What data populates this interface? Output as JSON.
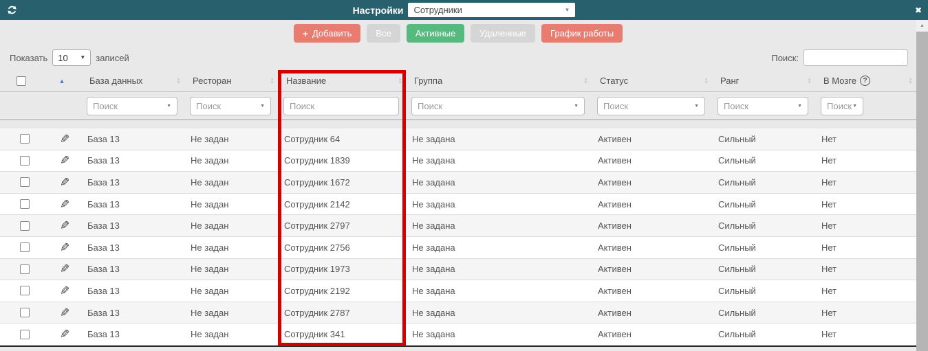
{
  "topbar": {
    "title": "Настройки",
    "module_select_value": "Сотрудники"
  },
  "toolbar": {
    "buttons": [
      {
        "name": "add",
        "label": "Добавить",
        "icon": "+",
        "variant": "salmon"
      },
      {
        "name": "all",
        "label": "Все",
        "variant": "gray"
      },
      {
        "name": "active",
        "label": "Активные",
        "variant": "green"
      },
      {
        "name": "deleted",
        "label": "Удаленные",
        "variant": "gray"
      },
      {
        "name": "work-schedule",
        "label": "График работы",
        "variant": "salmon"
      }
    ]
  },
  "length_control": {
    "prefix": "Показать",
    "value": "10",
    "suffix": "записей"
  },
  "search": {
    "label": "Поиск:",
    "value": ""
  },
  "icons": {
    "refresh": "circular-arrows",
    "close": "✖",
    "pencil": "✎",
    "caret_down": "▼",
    "sort_up": "▲",
    "sort_down": "▼",
    "help": "?"
  },
  "colors": {
    "topbar_teal": "#28606e",
    "accent_salmon": "#e87c71",
    "accent_green": "#56b97e",
    "button_gray": "#d5d5d5",
    "highlight_red": "#d40000",
    "sorted_arrow_blue": "#4a77d4"
  },
  "table": {
    "filter_placeholder": "Поиск",
    "columns": [
      {
        "key": "check",
        "type": "checkbox"
      },
      {
        "key": "edit",
        "sorted": "asc"
      },
      {
        "key": "db",
        "label": "База данных",
        "filter": "select"
      },
      {
        "key": "restaurant",
        "label": "Ресторан",
        "filter": "select"
      },
      {
        "key": "name",
        "label": "Название",
        "filter": "input",
        "highlighted": true
      },
      {
        "key": "group",
        "label": "Группа",
        "filter": "select"
      },
      {
        "key": "status",
        "label": "Статус",
        "filter": "select"
      },
      {
        "key": "rank",
        "label": "Ранг",
        "filter": "select"
      },
      {
        "key": "brain",
        "label": "В Мозге",
        "filter": "select",
        "help": true,
        "narrow_filter": true
      }
    ],
    "rows": [
      {
        "db": "База 13",
        "restaurant": "Не задан",
        "name": "Сотрудник 64",
        "group": "Не задана",
        "status": "Активен",
        "rank": "Сильный",
        "brain": "Нет"
      },
      {
        "db": "База 13",
        "restaurant": "Не задан",
        "name": "Сотрудник 1839",
        "group": "Не задана",
        "status": "Активен",
        "rank": "Сильный",
        "brain": "Нет"
      },
      {
        "db": "База 13",
        "restaurant": "Не задан",
        "name": "Сотрудник 1672",
        "group": "Не задана",
        "status": "Активен",
        "rank": "Сильный",
        "brain": "Нет"
      },
      {
        "db": "База 13",
        "restaurant": "Не задан",
        "name": "Сотрудник 2142",
        "group": "Не задана",
        "status": "Активен",
        "rank": "Сильный",
        "brain": "Нет"
      },
      {
        "db": "База 13",
        "restaurant": "Не задан",
        "name": "Сотрудник 2797",
        "group": "Не задана",
        "status": "Активен",
        "rank": "Сильный",
        "brain": "Нет"
      },
      {
        "db": "База 13",
        "restaurant": "Не задан",
        "name": "Сотрудник 2756",
        "group": "Не задана",
        "status": "Активен",
        "rank": "Сильный",
        "brain": "Нет"
      },
      {
        "db": "База 13",
        "restaurant": "Не задан",
        "name": "Сотрудник 1973",
        "group": "Не задана",
        "status": "Активен",
        "rank": "Сильный",
        "brain": "Нет"
      },
      {
        "db": "База 13",
        "restaurant": "Не задан",
        "name": "Сотрудник 2192",
        "group": "Не задана",
        "status": "Активен",
        "rank": "Сильный",
        "brain": "Нет"
      },
      {
        "db": "База 13",
        "restaurant": "Не задан",
        "name": "Сотрудник 2787",
        "group": "Не задана",
        "status": "Активен",
        "rank": "Сильный",
        "brain": "Нет"
      },
      {
        "db": "База 13",
        "restaurant": "Не задан",
        "name": "Сотрудник 341",
        "group": "Не задана",
        "status": "Активен",
        "rank": "Сильный",
        "brain": "Нет"
      }
    ]
  }
}
